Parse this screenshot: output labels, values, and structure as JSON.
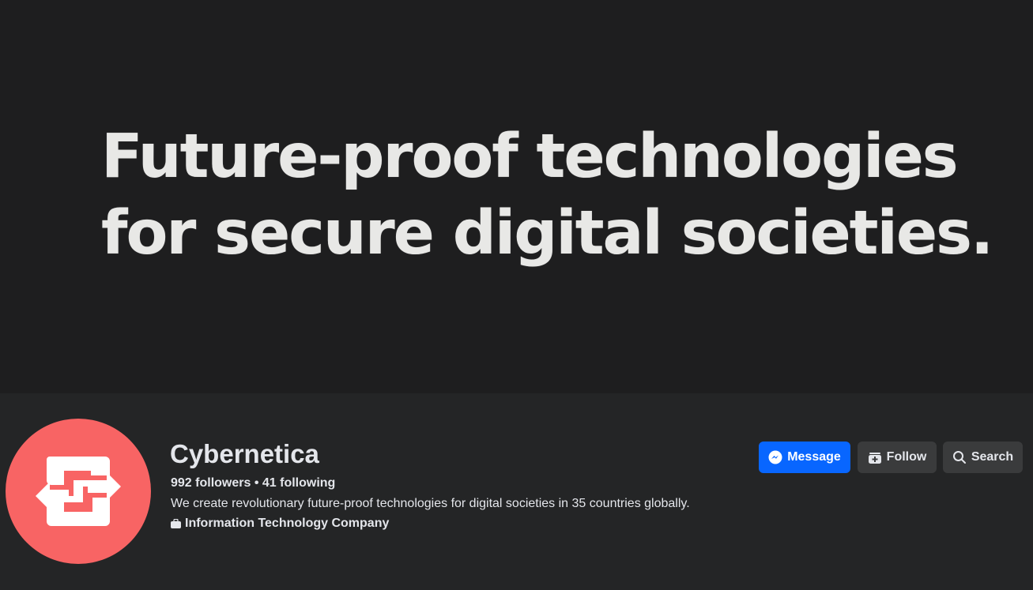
{
  "cover": {
    "headline_line1": "Future-proof technologies",
    "headline_line2": "for secure digital societies."
  },
  "page": {
    "name": "Cybernetica",
    "stats": "992 followers • 41 following",
    "description": "We create revolutionary future-proof technologies for digital societies in 35 countries globally.",
    "category": "Information Technology Company",
    "category_icon": "briefcase-icon",
    "avatar_color": "#f86464"
  },
  "actions": {
    "message_label": "Message",
    "message_icon": "messenger-icon",
    "follow_label": "Follow",
    "follow_icon": "add-follow-icon",
    "search_label": "Search",
    "search_icon": "search-icon",
    "primary_color": "#0866ff",
    "secondary_color": "#3a3b3c"
  }
}
